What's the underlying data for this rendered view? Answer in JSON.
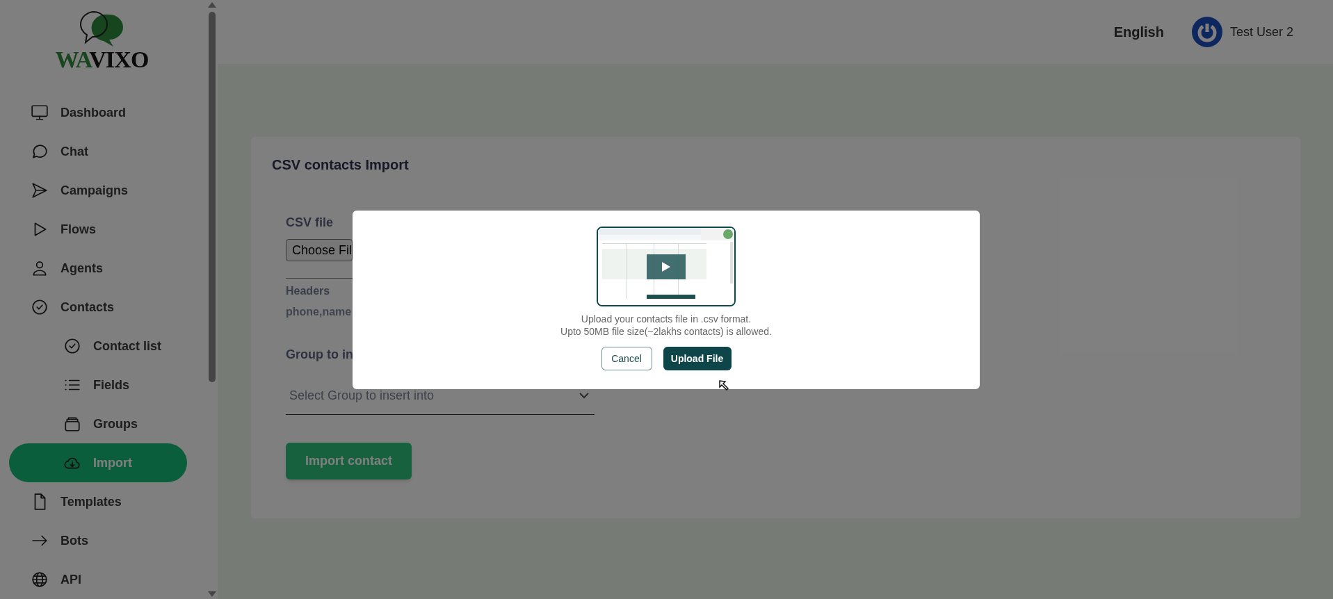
{
  "sidebar": {
    "logo": [
      {
        "text": "WA",
        "kind": "accent"
      },
      {
        "text": "VIXO",
        "kind": "plain"
      }
    ],
    "items": [
      {
        "label": "Dashboard",
        "selected": false
      },
      {
        "label": "Chat",
        "selected": false
      },
      {
        "label": "Campaigns",
        "selected": false
      },
      {
        "label": "Flows",
        "selected": false
      },
      {
        "label": "Agents",
        "selected": false
      },
      {
        "label": "Contacts",
        "selected": false,
        "children": [
          {
            "label": "Contact list",
            "selected": false
          },
          {
            "label": "Fields",
            "selected": false
          },
          {
            "label": "Groups",
            "selected": false
          },
          {
            "label": "Import",
            "selected": true
          }
        ]
      },
      {
        "label": "Templates",
        "selected": false
      },
      {
        "label": "Bots",
        "selected": false
      },
      {
        "label": "API",
        "selected": false
      }
    ]
  },
  "header": {
    "language": "English",
    "user": "Test User 2"
  },
  "card": {
    "title": "CSV contacts Import",
    "file_label": "CSV file",
    "file_button": "Choose Fil",
    "headers_label": "Headers",
    "headers_value": "phone,name",
    "group_label": "Group to in",
    "group_placeholder": "Select Group to insert into",
    "submit": "Import contact"
  },
  "modal": {
    "lines": [
      "Upload your contacts file in .csv format.",
      "Upto 50MB file size(~2lakhs contacts) is allowed."
    ],
    "buttons": [
      {
        "label": "Cancel",
        "kind": "secondary"
      },
      {
        "label": "Upload File",
        "kind": "primary"
      }
    ]
  }
}
